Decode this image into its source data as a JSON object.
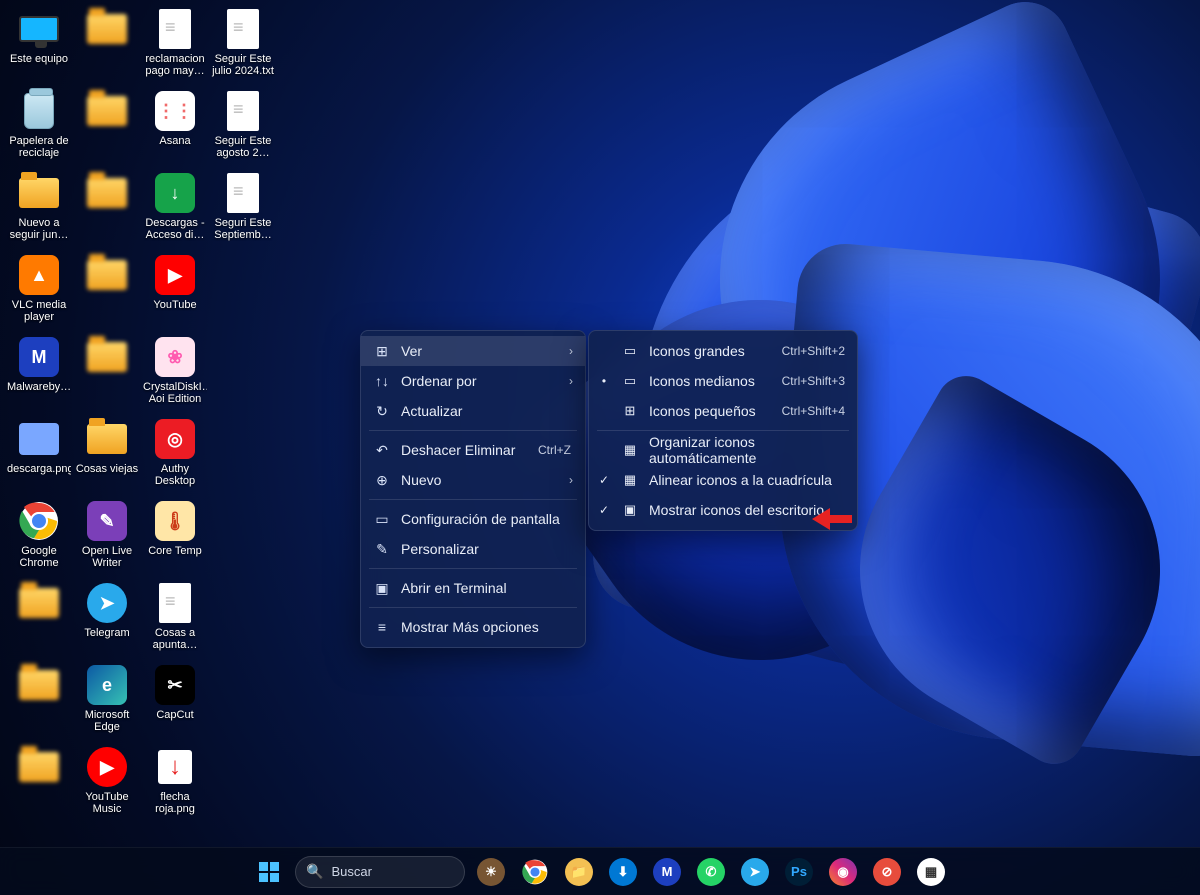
{
  "desktop_icons": [
    [
      {
        "label": "Este equipo",
        "type": "monitor",
        "name": "este-equipo"
      },
      {
        "label": "",
        "type": "folder",
        "blur": true
      },
      {
        "label": "reclamacion pago may…",
        "type": "file",
        "name": "reclamacion-pago"
      },
      {
        "label": "Seguir Este julio 2024.txt",
        "type": "file",
        "name": "seguir-julio"
      }
    ],
    [
      {
        "label": "Papelera de reciclaje",
        "type": "trash",
        "name": "papelera"
      },
      {
        "label": "",
        "type": "folder",
        "blur": true
      },
      {
        "label": "Asana",
        "type": "app",
        "bg": "#fff",
        "fg": "#f06a6a",
        "glyph": "⋮⋮",
        "name": "asana"
      },
      {
        "label": "Seguir Este agosto 2…",
        "type": "file",
        "name": "seguir-agosto"
      }
    ],
    [
      {
        "label": "Nuevo a seguir jun…",
        "type": "folder",
        "name": "nuevo-seguir"
      },
      {
        "label": "",
        "type": "folder",
        "blur": true
      },
      {
        "label": "Descargas - Acceso di…",
        "type": "app",
        "bg": "#16a34a",
        "fg": "#fff",
        "glyph": "↓",
        "name": "descargas"
      },
      {
        "label": "Seguri Este Septiemb…",
        "type": "file",
        "name": "seguir-sept"
      }
    ],
    [
      {
        "label": "VLC media player",
        "type": "app",
        "bg": "#ff7a00",
        "fg": "#fff",
        "glyph": "▲",
        "name": "vlc"
      },
      {
        "label": "",
        "type": "folder",
        "blur": true
      },
      {
        "label": "YouTube",
        "type": "app",
        "bg": "#ff0000",
        "fg": "#fff",
        "glyph": "▶",
        "name": "youtube"
      }
    ],
    [
      {
        "label": "Malwareby…",
        "type": "app",
        "bg": "#1d3fbf",
        "fg": "#fff",
        "glyph": "M",
        "name": "malwarebytes"
      },
      {
        "label": "",
        "type": "folder",
        "blur": true
      },
      {
        "label": "CrystalDiskI… Aoi Edition",
        "type": "app",
        "bg": "#ffe3ef",
        "fg": "#ff5bb0",
        "glyph": "❀",
        "name": "crystaldisk"
      }
    ],
    [
      {
        "label": "descarga.png",
        "type": "png",
        "bg": "#7aa7ff",
        "name": "descarga-png"
      },
      {
        "label": "Cosas viejas",
        "type": "folder",
        "name": "cosas-viejas"
      },
      {
        "label": "Authy Desktop",
        "type": "app",
        "bg": "#ec1c24",
        "fg": "#fff",
        "glyph": "◎",
        "name": "authy"
      }
    ],
    [
      {
        "label": "Google Chrome",
        "type": "chrome",
        "name": "chrome"
      },
      {
        "label": "Open Live Writer",
        "type": "app",
        "bg": "#7b3fb8",
        "fg": "#fff",
        "glyph": "✎",
        "name": "open-live-writer"
      },
      {
        "label": "Core Temp",
        "type": "app",
        "bg": "#ffe6a7",
        "fg": "#cc3b18",
        "glyph": "🌡",
        "name": "core-temp"
      }
    ],
    [
      {
        "label": "",
        "type": "folder",
        "blur": true
      },
      {
        "label": "Telegram",
        "type": "app",
        "bg": "#29a9eb",
        "fg": "#fff",
        "glyph": "➤",
        "round": true,
        "name": "telegram"
      },
      {
        "label": "Cosas a apunta…",
        "type": "file",
        "name": "cosas-apuntar"
      }
    ],
    [
      {
        "label": "",
        "type": "folder",
        "blur": true
      },
      {
        "label": "Microsoft Edge",
        "type": "app",
        "bg": "linear-gradient(135deg,#0c59a4,#36c2b4)",
        "fg": "#fff",
        "glyph": "e",
        "name": "edge"
      },
      {
        "label": "CapCut",
        "type": "app",
        "bg": "#000",
        "fg": "#fff",
        "glyph": "✂",
        "name": "capcut"
      }
    ],
    [
      {
        "label": "",
        "type": "folder",
        "blur": true
      },
      {
        "label": "YouTube Music",
        "type": "app",
        "bg": "#ff0000",
        "fg": "#fff",
        "glyph": "▶",
        "round": true,
        "name": "youtube-music"
      },
      {
        "label": "flecha roja.png",
        "type": "arrowpng",
        "name": "flecha-roja"
      }
    ]
  ],
  "context_menu": {
    "items": [
      {
        "icon": "⊞",
        "label": "Ver",
        "submenu": true,
        "hovered": true,
        "name": "ver"
      },
      {
        "icon": "↑↓",
        "label": "Ordenar por",
        "submenu": true,
        "name": "ordenar-por"
      },
      {
        "icon": "↻",
        "label": "Actualizar",
        "name": "actualizar"
      },
      {
        "sep": true
      },
      {
        "icon": "↶",
        "label": "Deshacer Eliminar",
        "hint": "Ctrl+Z",
        "name": "deshacer"
      },
      {
        "icon": "⊕",
        "label": "Nuevo",
        "submenu": true,
        "name": "nuevo"
      },
      {
        "sep": true
      },
      {
        "icon": "▭",
        "label": "Configuración de pantalla",
        "name": "config-pantalla"
      },
      {
        "icon": "✎",
        "label": "Personalizar",
        "name": "personalizar"
      },
      {
        "sep": true
      },
      {
        "icon": "▣",
        "label": "Abrir en Terminal",
        "name": "abrir-terminal"
      },
      {
        "sep": true
      },
      {
        "icon": "≡",
        "label": "Mostrar Más opciones",
        "name": "mas-opciones"
      }
    ]
  },
  "submenu": {
    "items": [
      {
        "check": "",
        "icon": "▭",
        "label": "Iconos grandes",
        "hint": "Ctrl+Shift+2",
        "name": "iconos-grandes"
      },
      {
        "check": "•",
        "icon": "▭",
        "label": "Iconos medianos",
        "hint": "Ctrl+Shift+3",
        "name": "iconos-medianos"
      },
      {
        "check": "",
        "icon": "⊞",
        "label": "Iconos pequeños",
        "hint": "Ctrl+Shift+4",
        "name": "iconos-pequenos"
      },
      {
        "sep": true
      },
      {
        "check": "",
        "icon": "▦",
        "label": "Organizar iconos automáticamente",
        "name": "organizar-auto"
      },
      {
        "check": "✓",
        "icon": "▦",
        "label": "Alinear iconos a la cuadrícula",
        "name": "alinear-cuadricula"
      },
      {
        "check": "✓",
        "icon": "▣",
        "label": "Mostrar iconos del escritorio",
        "name": "mostrar-iconos"
      }
    ]
  },
  "taskbar": {
    "search_placeholder": "Buscar",
    "apps": [
      {
        "name": "weather",
        "bg": "#775533",
        "glyph": "☀"
      },
      {
        "name": "chrome"
      },
      {
        "name": "explorer",
        "bg": "#f3c053",
        "glyph": "📁"
      },
      {
        "name": "store",
        "bg": "#0078d4",
        "glyph": "⬇",
        "fg": "#fff"
      },
      {
        "name": "malwarebytes",
        "bg": "#1d3fbf",
        "glyph": "M",
        "fg": "#fff"
      },
      {
        "name": "whatsapp",
        "bg": "#25d366",
        "glyph": "✆",
        "fg": "#fff"
      },
      {
        "name": "telegram",
        "bg": "#29a9eb",
        "glyph": "➤",
        "fg": "#fff"
      },
      {
        "name": "photoshop",
        "bg": "#001e36",
        "glyph": "Ps",
        "fg": "#31a8ff"
      },
      {
        "name": "instagram",
        "bg": "linear-gradient(45deg,#f58529,#dd2a7b,#8134af)",
        "glyph": "◉",
        "fg": "#fff"
      },
      {
        "name": "distraction",
        "bg": "#e74c3c",
        "glyph": "⊘",
        "fg": "#fff"
      },
      {
        "name": "unknown",
        "bg": "#fff",
        "glyph": "▦",
        "fg": "#333"
      }
    ]
  }
}
